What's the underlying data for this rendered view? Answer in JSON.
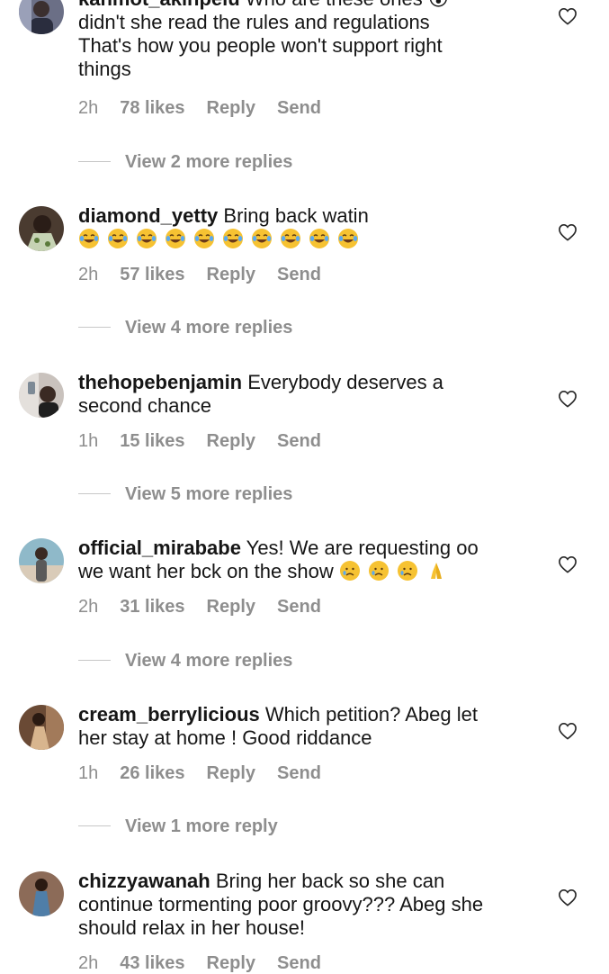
{
  "colors": {
    "text": "#161616",
    "muted": "#8e8e8e",
    "emoji_yellow": "#f6c232",
    "emoji_tear": "#5aa9f0"
  },
  "comments": [
    {
      "username": "kahmot_akinpelu",
      "text": "Who are these ones 😮\ndidn't she read the rules and regulations\nThat's how you people won't support right\nthings",
      "time": "2h",
      "likes": "78 likes",
      "reply": "Reply",
      "send": "Send",
      "view_replies": "View 2 more replies",
      "icon": "heart-outline-icon"
    },
    {
      "username": "diamond_yetty",
      "text": "Bring back watin",
      "emojis": [
        "joy-emoji",
        "joy-emoji",
        "joy-emoji",
        "joy-emoji",
        "joy-emoji",
        "joy-emoji",
        "joy-emoji",
        "joy-emoji",
        "joy-emoji",
        "joy-emoji"
      ],
      "time": "2h",
      "likes": "57 likes",
      "reply": "Reply",
      "send": "Send",
      "view_replies": "View 4 more replies",
      "icon": "heart-outline-icon"
    },
    {
      "username": "thehopebenjamin",
      "text": "Everybody deserves a\nsecond chance",
      "time": "1h",
      "likes": "15 likes",
      "reply": "Reply",
      "send": "Send",
      "view_replies": "View 5 more replies",
      "icon": "heart-outline-icon"
    },
    {
      "username": "official_mirababe",
      "text": "Yes! We are requesting oo\nwe want her bck on the show",
      "emojis": [
        "crying-emoji",
        "crying-emoji",
        "crying-emoji",
        "folded-hands-emoji"
      ],
      "time": "2h",
      "likes": "31 likes",
      "reply": "Reply",
      "send": "Send",
      "view_replies": "View 4 more replies",
      "icon": "heart-outline-icon"
    },
    {
      "username": "cream_berrylicious",
      "text": "Which petition? Abeg let\nher stay at home ! Good riddance",
      "time": "1h",
      "likes": "26 likes",
      "reply": "Reply",
      "send": "Send",
      "view_replies": "View 1 more reply",
      "icon": "heart-outline-icon"
    },
    {
      "username": "chizzyawanah",
      "text": "Bring her back so she can\ncontinue tormenting poor groovy??? Abeg she\nshould relax in her house!",
      "time": "2h",
      "likes": "43 likes",
      "reply": "Reply",
      "send": "Send",
      "icon": "heart-outline-icon"
    }
  ]
}
